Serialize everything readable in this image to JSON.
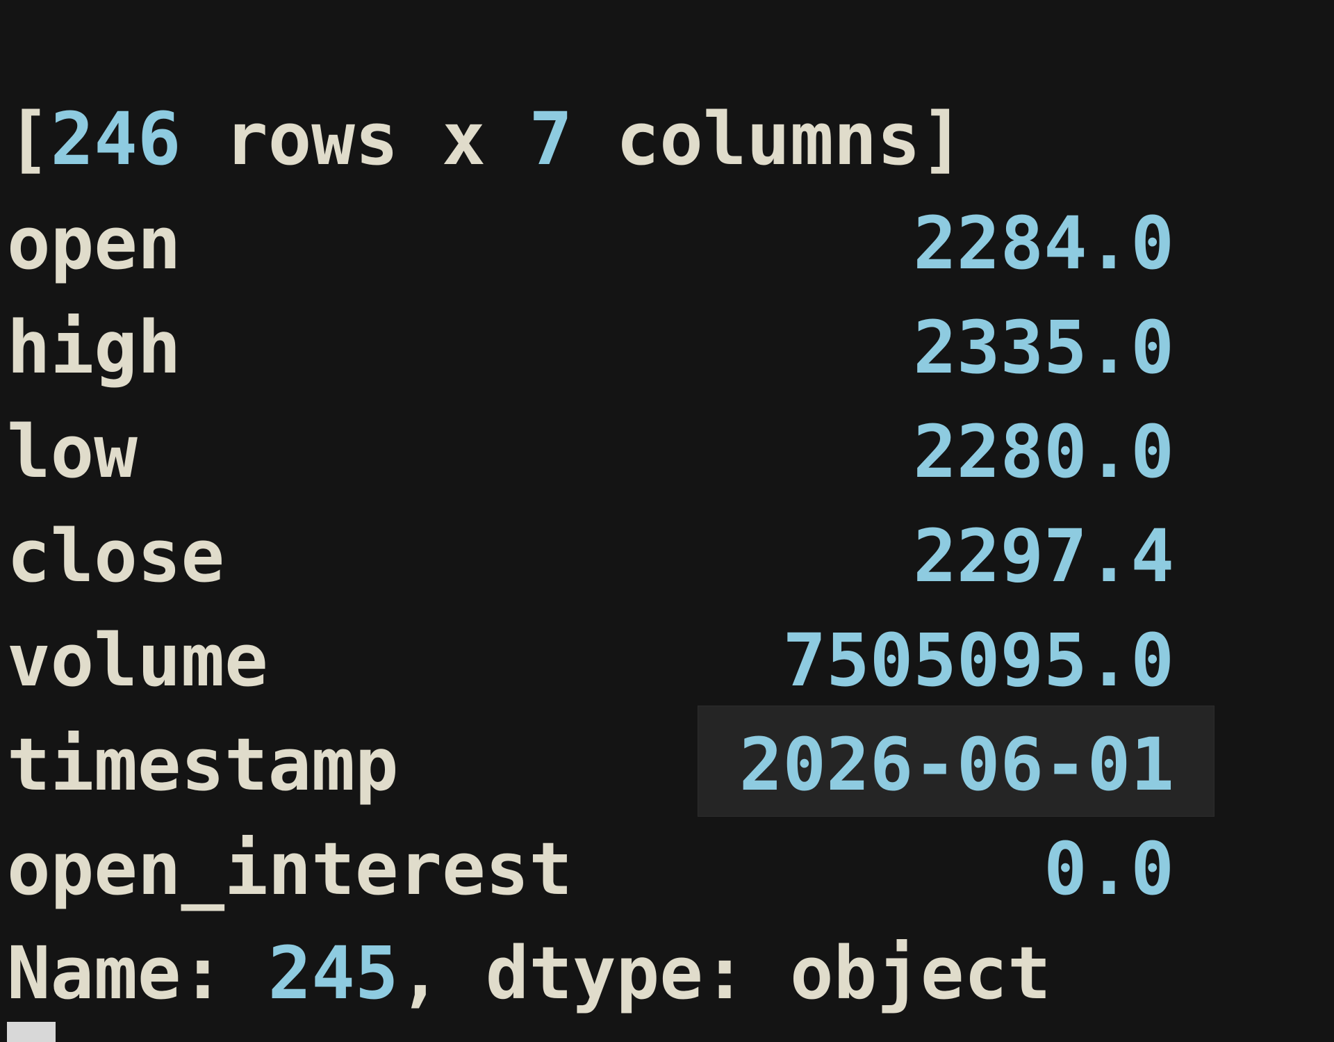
{
  "summary": {
    "bracket_open": "[",
    "rows": "246",
    "rows_text": " rows x ",
    "cols": "7",
    "cols_text": " columns",
    "bracket_close": "]"
  },
  "fields": [
    {
      "name": "open",
      "value": "2284.0"
    },
    {
      "name": "high",
      "value": "2335.0"
    },
    {
      "name": "low",
      "value": "2280.0"
    },
    {
      "name": "close",
      "value": "2297.4"
    },
    {
      "name": "volume",
      "value": "7505095.0"
    },
    {
      "name": "timestamp",
      "value": "2026-06-01"
    },
    {
      "name": "open_interest",
      "value": "0.0"
    }
  ],
  "footer": {
    "name_label": "Name: ",
    "name_value": "245",
    "dtype_text": ", dtype: object"
  },
  "colors": {
    "background": "#141414",
    "text": "#e0dccb",
    "number": "#8ecbe0",
    "selection": "#252525"
  }
}
